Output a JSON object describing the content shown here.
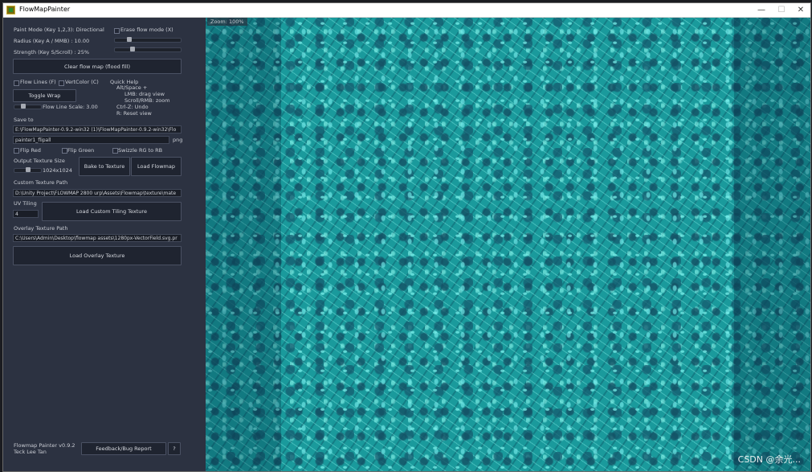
{
  "window": {
    "title": "FlowMapPainter",
    "minimize": "—",
    "maximize": "☐",
    "close": "✕"
  },
  "panel": {
    "paint_mode": "Paint Mode (Key 1,2,3): Directional",
    "erase_label": "Erase flow mode (X)",
    "radius": "Radius (Key A / MMB) : 10.00",
    "strength": "Strength (Key S/Scroll) : 25%",
    "clear_button": "Clear flow map (flood fill)",
    "flow_lines": "Flow Lines (F)",
    "vert_color": "VertColor (C)",
    "toggle_wrap": "Toggle Wrap",
    "flow_line_scale": "Flow Line Scale: 3.00",
    "quick_help": {
      "title": "Quick Help",
      "lines": [
        "Alt/Space +",
        "LMB: drag view",
        "Scroll/RMB: zoom",
        "Ctrl-Z: Undo",
        "R: Reset view"
      ]
    },
    "save_to": "Save to",
    "save_path": "E:\\FlowMapPainter-0.9.2-win32 (1)\\FlowMapPainter-0.9.2-win32\\Flo",
    "file_name": "painter1_flipall",
    "file_ext": "png",
    "flip_red": "Flip Red",
    "flip_green": "Flip Green",
    "swizzle": "Swizzle RG to RB",
    "output_size_label": "Output Texture Size",
    "output_size_value": "1024x1024",
    "bake_button": "Bake to Texture",
    "load_flowmap_button": "Load Flowmap",
    "custom_texture_label": "Custom Texture Path",
    "custom_texture_path": "D:\\Unity Project\\FLOWMAP 2800 urp\\Assets\\Flowmap\\texture\\mate",
    "uv_tiling_label": "UV Tiling",
    "uv_tiling_value": "4",
    "load_tiling_button": "Load Custom Tiling Texture",
    "overlay_label": "Overlay Texture Path",
    "overlay_path": "C:\\Users\\Admin\\Desktop\\flowmap assets\\1280px-VectorField.svg.pr",
    "load_overlay_button": "Load Overlay Texture",
    "footer_version": "Flowmap Painter v0.9.2",
    "footer_author": "Teck Lee Tan",
    "feedback_button": "Feedback/Bug Report",
    "help_button": "?"
  },
  "controls": {
    "radius_level": 0.2,
    "strength_level": 0.25,
    "flow_line_scale_level": 0.3,
    "output_size_level": 0.5
  },
  "canvas": {
    "zoom": "Zoom: 100%"
  },
  "watermark": "CSDN @余光..."
}
